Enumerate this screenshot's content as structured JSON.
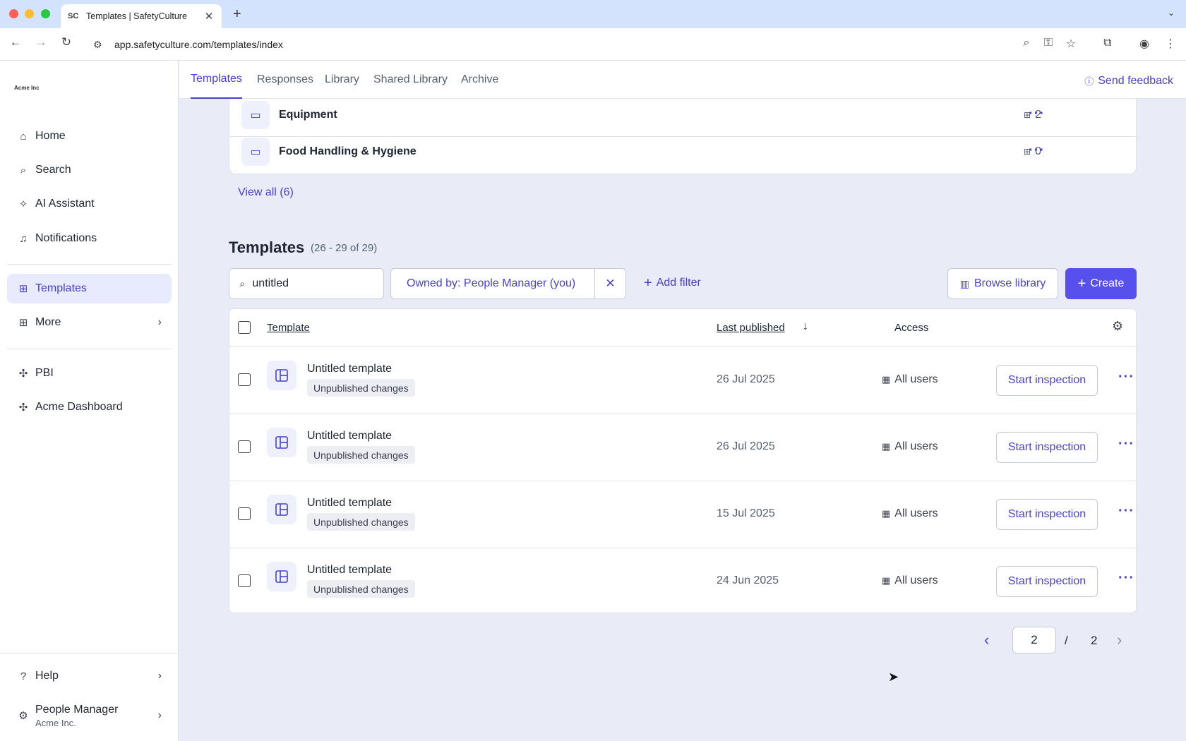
{
  "browser": {
    "tab_favicon": "SC",
    "tab_title": "Templates | SafetyCulture",
    "tab_close": "✕",
    "new_tab": "+",
    "url": "app.safetyculture.com/templates/index"
  },
  "sidebar": {
    "logo": "Acme Inc",
    "items": [
      {
        "label": "Home",
        "icon": "home-icon"
      },
      {
        "label": "Search",
        "icon": "search-icon"
      },
      {
        "label": "AI Assistant",
        "icon": "sparkle-icon"
      },
      {
        "label": "Notifications",
        "icon": "bell-icon"
      },
      {
        "label": "Templates",
        "icon": "template-icon",
        "active": true
      },
      {
        "label": "More",
        "icon": "grid-icon"
      },
      {
        "label": "PBI",
        "icon": "puzzle-icon"
      },
      {
        "label": "Acme Dashboard",
        "icon": "puzzle-icon"
      }
    ],
    "help_label": "Help",
    "user": {
      "name": "People Manager",
      "org": "Acme Inc."
    }
  },
  "topnav": {
    "tabs": [
      "Templates",
      "Responses",
      "Library",
      "Shared Library",
      "Archive"
    ],
    "active_tab": "Templates",
    "feedback_label": "Send feedback"
  },
  "folders": {
    "rows": [
      {
        "name": "Equipment",
        "count": "2"
      },
      {
        "name": "Food Handling & Hygiene",
        "count": "0"
      }
    ],
    "view_all_label": "View all (6)"
  },
  "templates": {
    "title": "Templates",
    "range": "(26 - 29 of 29)",
    "search_value": "untitled",
    "filter_label": "Owned by: People Manager (you)",
    "add_filter_label": "Add filter",
    "browse_label": "Browse library",
    "create_label": "Create",
    "columns": {
      "template": "Template",
      "last_published": "Last published",
      "access": "Access"
    },
    "rows": [
      {
        "name": "Untitled template",
        "badge": "Unpublished changes",
        "date": "26 Jul 2025",
        "access": "All users",
        "action": "Start inspection"
      },
      {
        "name": "Untitled template",
        "badge": "Unpublished changes",
        "date": "26 Jul 2025",
        "access": "All users",
        "action": "Start inspection"
      },
      {
        "name": "Untitled template",
        "badge": "Unpublished changes",
        "date": "15 Jul 2025",
        "access": "All users",
        "action": "Start inspection"
      },
      {
        "name": "Untitled template",
        "badge": "Unpublished changes",
        "date": "24 Jun 2025",
        "access": "All users",
        "action": "Start inspection"
      }
    ]
  },
  "pagination": {
    "current": "2",
    "separator": "/",
    "total": "2"
  },
  "colors": {
    "accent": "#4740d4",
    "primary_button": "#5850ec",
    "background": "#e9ecf7"
  }
}
